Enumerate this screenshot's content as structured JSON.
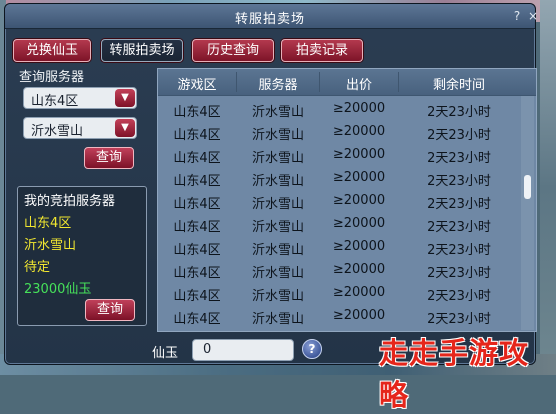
{
  "window": {
    "title": "转服拍卖场",
    "help_glyph": "?",
    "close_glyph": "×"
  },
  "tabs": [
    {
      "label": "兑换仙玉"
    },
    {
      "label": "转服拍卖场"
    },
    {
      "label": "历史查询"
    },
    {
      "label": "拍卖记录"
    }
  ],
  "query": {
    "label": "查询服务器",
    "server_select": "山东4区",
    "zone_select": "沂水雪山",
    "button": "查询",
    "arrow_glyph": "▼"
  },
  "my_bid": {
    "title": "我的竞拍服务器",
    "server": "山东4区",
    "zone": "沂水雪山",
    "status": "待定",
    "amount": "23000仙玉",
    "button": "查询"
  },
  "table": {
    "headers": [
      "游戏区",
      "服务器",
      "出价",
      "剩余时间"
    ],
    "rows": [
      [
        "山东4区",
        "沂水雪山",
        "≥20000",
        "2天23小时"
      ],
      [
        "山东4区",
        "沂水雪山",
        "≥20000",
        "2天23小时"
      ],
      [
        "山东4区",
        "沂水雪山",
        "≥20000",
        "2天23小时"
      ],
      [
        "山东4区",
        "沂水雪山",
        "≥20000",
        "2天23小时"
      ],
      [
        "山东4区",
        "沂水雪山",
        "≥20000",
        "2天23小时"
      ],
      [
        "山东4区",
        "沂水雪山",
        "≥20000",
        "2天23小时"
      ],
      [
        "山东4区",
        "沂水雪山",
        "≥20000",
        "2天23小时"
      ],
      [
        "山东4区",
        "沂水雪山",
        "≥20000",
        "2天23小时"
      ],
      [
        "山东4区",
        "沂水雪山",
        "≥20000",
        "2天23小时"
      ],
      [
        "山东4区",
        "沂水雪山",
        "≥20000",
        "2天23小时"
      ]
    ]
  },
  "footer": {
    "label": "仙玉",
    "value": "0",
    "help_glyph": "?"
  },
  "watermark": "走走手游攻略",
  "colors": {
    "tab_red": "#9b2238",
    "table_bg": "#6f88a5",
    "highlight_yellow": "#f2e830",
    "amount_green": "#46e05a"
  }
}
